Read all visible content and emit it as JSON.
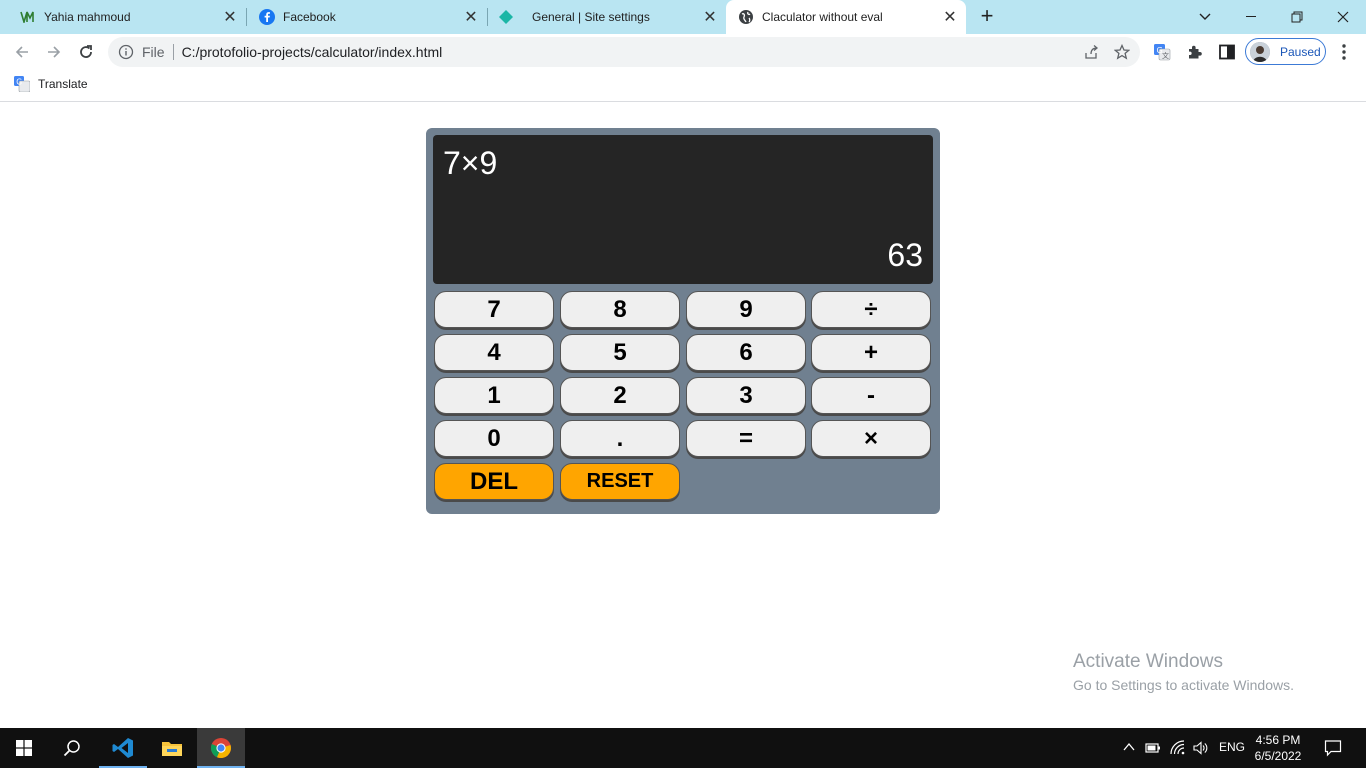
{
  "browser": {
    "tabs": [
      {
        "label": "Yahia mahmoud",
        "icon": "ym-logo-icon",
        "active": false
      },
      {
        "label": "Facebook",
        "icon": "facebook-icon",
        "active": false
      },
      {
        "label": "General | Site settings",
        "icon": "diamond-icon",
        "active": false
      },
      {
        "label": "Claculator without eval",
        "icon": "globe-icon",
        "active": true
      }
    ],
    "url_scheme": "File",
    "url": "C:/protofolio-projects/calculator/index.html",
    "profile_label": "Paused",
    "bookmarks": [
      {
        "label": "Translate",
        "icon": "google-translate-icon"
      }
    ]
  },
  "calculator": {
    "expression": "7×9",
    "result": "63",
    "keys": [
      [
        "7",
        "8",
        "9",
        "÷"
      ],
      [
        "4",
        "5",
        "6",
        "+"
      ],
      [
        "1",
        "2",
        "3",
        "-"
      ],
      [
        "0",
        ".",
        "=",
        "×"
      ]
    ],
    "del_label": "DEL",
    "reset_label": "RESET",
    "colors": {
      "body": "#708090",
      "display": "#252525",
      "key": "#efefef",
      "action": "#ffa500"
    }
  },
  "watermark": {
    "title": "Activate Windows",
    "subtitle": "Go to Settings to activate Windows."
  },
  "taskbar": {
    "apps": [
      "windows-start-icon",
      "search-icon",
      "vscode-icon",
      "file-explorer-icon",
      "chrome-icon"
    ],
    "language": "ENG",
    "time": "4:56 PM",
    "date": "6/5/2022"
  }
}
